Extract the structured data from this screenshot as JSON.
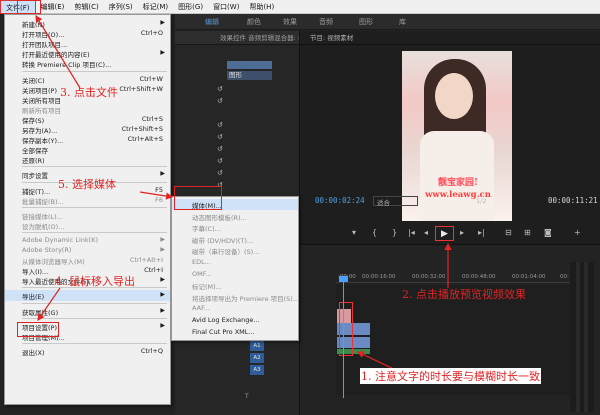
{
  "menubar": [
    "文件(F)",
    "编辑(E)",
    "剪辑(C)",
    "序列(S)",
    "标记(M)",
    "图形(G)",
    "窗口(W)",
    "帮助(H)"
  ],
  "workspace_tabs": [
    "编辑",
    "颜色",
    "效果",
    "音频",
    "图形",
    "库"
  ],
  "source_panel_title": "效果控件   音频剪辑混合器: 视频素材",
  "clip_name": "图形",
  "program": {
    "title": "节目: 视频素材",
    "watermark_name": "靓宝家园!",
    "watermark_url": "www.leawg.cn",
    "timecode_current": "00:00:02:24",
    "fit": "适合",
    "ratio": "1/2",
    "timecode_total": "00:00:11:21"
  },
  "ruler_ticks": [
    ":00:00",
    "00:00:16:00",
    "00:00:32:00",
    "00:00:48:00",
    "00:01:04:00",
    "00:"
  ],
  "tracks": [
    "V1",
    "A1",
    "A2",
    "A3"
  ],
  "file_menu": [
    {
      "label": "新建(N)",
      "shortcut": "",
      "sub": true
    },
    {
      "label": "打开项目(O)...",
      "shortcut": "Ctrl+O"
    },
    {
      "label": "打开团队项目...",
      "shortcut": ""
    },
    {
      "label": "打开最近使用的内容(E)",
      "shortcut": "",
      "sub": true
    },
    {
      "label": "转换 Premiere Clip 项目(C)...",
      "shortcut": ""
    },
    {
      "sep": true
    },
    {
      "label": "关闭(C)",
      "shortcut": "Ctrl+W"
    },
    {
      "label": "关闭项目(P)",
      "shortcut": "Ctrl+Shift+W"
    },
    {
      "label": "关闭所有项目",
      "shortcut": ""
    },
    {
      "label": "刷新所有项目",
      "shortcut": "",
      "disabled": true
    },
    {
      "label": "保存(S)",
      "shortcut": "Ctrl+S"
    },
    {
      "label": "另存为(A)...",
      "shortcut": "Ctrl+Shift+S"
    },
    {
      "label": "保存副本(Y)...",
      "shortcut": "Ctrl+Alt+S"
    },
    {
      "label": "全部保存",
      "shortcut": ""
    },
    {
      "label": "还原(R)",
      "shortcut": ""
    },
    {
      "sep": true
    },
    {
      "label": "同步设置",
      "shortcut": "",
      "sub": true
    },
    {
      "sep": true
    },
    {
      "label": "捕捉(T)...",
      "shortcut": "F5"
    },
    {
      "label": "批量捕捉(B)...",
      "shortcut": "F6",
      "disabled": true
    },
    {
      "sep": true
    },
    {
      "label": "链接媒体(L)...",
      "shortcut": "",
      "disabled": true
    },
    {
      "label": "设为脱机(O)...",
      "shortcut": "",
      "disabled": true
    },
    {
      "sep": true
    },
    {
      "label": "Adobe Dynamic Link(K)",
      "shortcut": "",
      "sub": true,
      "disabled": true
    },
    {
      "label": "Adobe Story(R)",
      "shortcut": "",
      "sub": true,
      "disabled": true
    },
    {
      "label": "从媒体浏览器导入(M)",
      "shortcut": "Ctrl+Alt+I",
      "disabled": true
    },
    {
      "label": "导入(I)...",
      "shortcut": "Ctrl+I"
    },
    {
      "label": "导入最近使用的文件(F)",
      "shortcut": "",
      "sub": true
    },
    {
      "sep": true
    },
    {
      "label": "导出(E)",
      "shortcut": "",
      "sub": true,
      "highlight": true
    },
    {
      "sep": true
    },
    {
      "label": "获取属性(G)",
      "shortcut": "",
      "sub": true
    },
    {
      "sep": true
    },
    {
      "label": "项目设置(P)",
      "shortcut": "",
      "sub": true
    },
    {
      "label": "项目管理(M)...",
      "shortcut": ""
    },
    {
      "sep": true
    },
    {
      "label": "退出(X)",
      "shortcut": "Ctrl+Q"
    }
  ],
  "export_menu": [
    {
      "label": "媒体(M)...",
      "highlight": true
    },
    {
      "label": "动态图形模板(R)...",
      "disabled": true
    },
    {
      "label": "字幕(C)...",
      "disabled": true
    },
    {
      "label": "磁带 (DV/HDV)(T)...",
      "disabled": true
    },
    {
      "label": "磁带（串行设备）(S)...",
      "disabled": true
    },
    {
      "label": "EDL...",
      "disabled": true
    },
    {
      "label": "OMF...",
      "disabled": true
    },
    {
      "label": "标记(M)...",
      "disabled": true
    },
    {
      "label": "将选择项导出为 Premiere 项目(S)...",
      "disabled": true
    },
    {
      "label": "AAF...",
      "disabled": true
    },
    {
      "label": "Avid Log Exchange..."
    },
    {
      "label": "Final Cut Pro XML..."
    }
  ],
  "annotations": {
    "step1": "1. 注意文字的时长要与模糊时长一致",
    "step2": "2. 点击播放预览视频效果",
    "step3": "3. 点击文件",
    "step4": "4. 鼠标移入导出",
    "step5": "5. 选择媒体"
  },
  "annotation_color": "#e02424",
  "accent_color": "#4f9fe8"
}
